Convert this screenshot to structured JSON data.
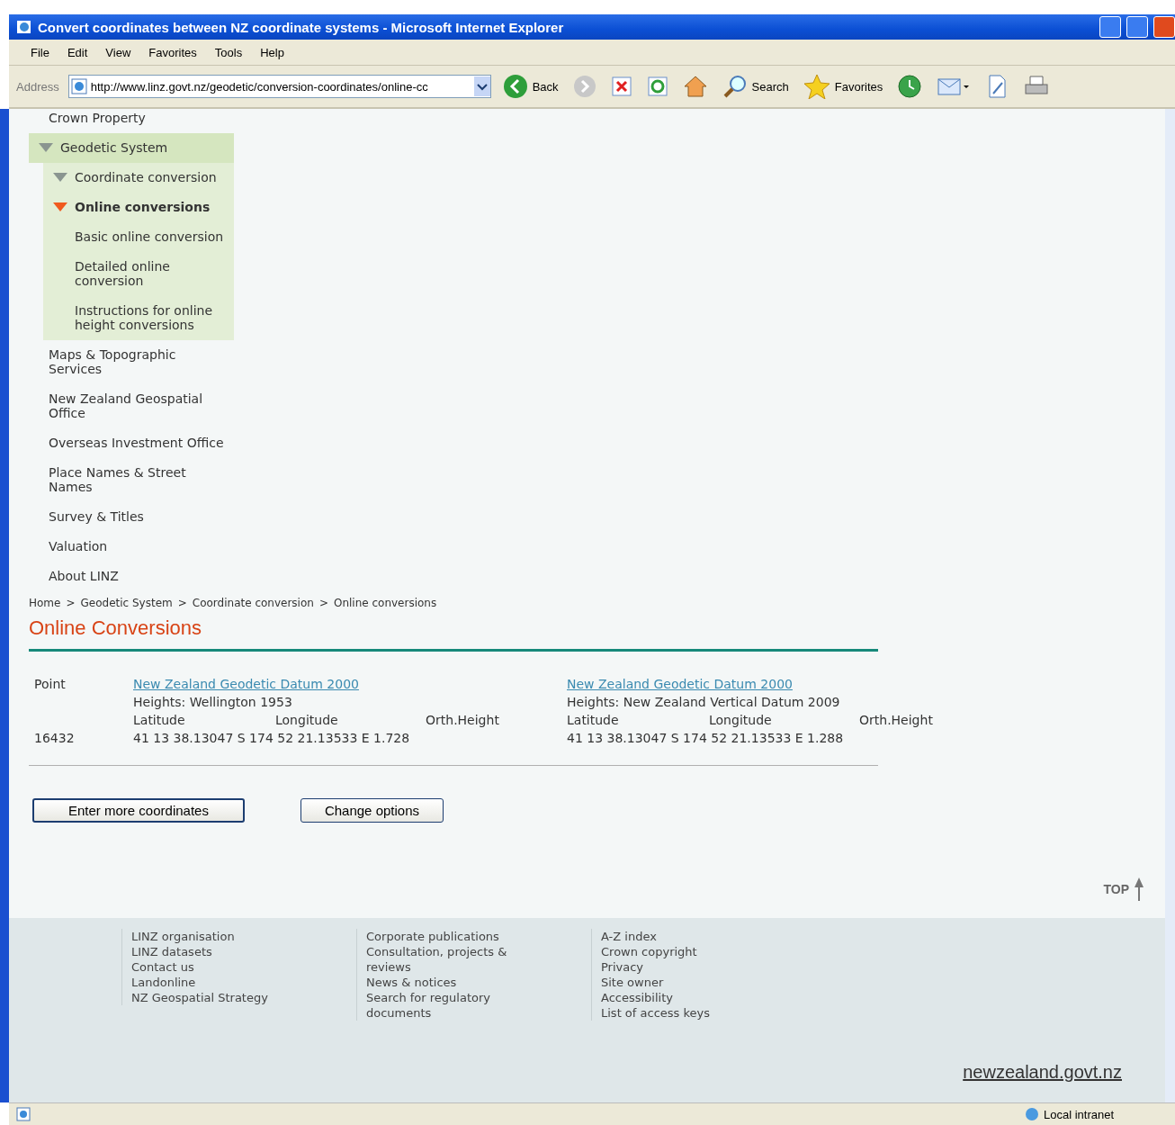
{
  "window": {
    "title": "Convert coordinates between NZ coordinate systems - Microsoft Internet Explorer"
  },
  "menu": [
    "File",
    "Edit",
    "View",
    "Favorites",
    "Tools",
    "Help"
  ],
  "toolbar": {
    "address_label": "Address",
    "address": "http://www.linz.govt.nz/geodetic/conversion-coordinates/online-cc",
    "buttons": [
      {
        "kind": "back",
        "label": "Back"
      },
      {
        "kind": "forward"
      },
      {
        "kind": "stop"
      },
      {
        "kind": "refresh"
      },
      {
        "kind": "home"
      },
      {
        "kind": "search",
        "label": "Search"
      },
      {
        "kind": "favorites",
        "label": "Favorites"
      },
      {
        "kind": "history"
      },
      {
        "kind": "mail"
      },
      {
        "kind": "edit"
      },
      {
        "kind": "print"
      }
    ]
  },
  "nav": [
    {
      "label": "Crown Property",
      "expanded": false,
      "selected": false
    },
    {
      "label": "Geodetic System",
      "expanded": true,
      "selected": false,
      "children": [
        {
          "label": "Coordinate conversion",
          "expanded": true,
          "selected": false,
          "children": [
            {
              "label": "Online conversions",
              "expanded": true,
              "selected": true,
              "children": [
                {
                  "label": "Basic online conversion",
                  "expanded": false,
                  "selected": false
                },
                {
                  "label": "Detailed online conversion",
                  "expanded": false,
                  "selected": false
                },
                {
                  "label": "Instructions for online height conversions",
                  "expanded": false,
                  "selected": false
                }
              ]
            }
          ]
        }
      ]
    },
    {
      "label": "Maps & Topographic Services",
      "expanded": false,
      "selected": false
    },
    {
      "label": "New Zealand Geospatial Office",
      "expanded": false,
      "selected": false
    },
    {
      "label": "Overseas Investment Office",
      "expanded": false,
      "selected": false
    },
    {
      "label": "Place Names & Street Names",
      "expanded": false,
      "selected": false
    },
    {
      "label": "Survey & Titles",
      "expanded": false,
      "selected": false
    },
    {
      "label": "Valuation",
      "expanded": false,
      "selected": false
    },
    {
      "label": "About LINZ",
      "expanded": false,
      "selected": false
    }
  ],
  "breadcrumb": [
    "Home",
    "Geodetic System",
    "Coordinate conversion",
    "Online conversions"
  ],
  "breadcrumb_separator": ">",
  "heading": "Online Conversions",
  "results": {
    "point_label": "Point",
    "point_id": "16432",
    "systems": [
      {
        "datum": "New Zealand Geodetic Datum 2000",
        "heights": "Heights: Wellington 1953",
        "headers": [
          "Latitude",
          "Longitude",
          "Orth.Height"
        ],
        "values": "41 13 38.13047 S 174 52 21.13533 E 1.728"
      },
      {
        "datum": "New Zealand Geodetic Datum 2000",
        "heights": "Heights: New Zealand Vertical Datum 2009",
        "headers": [
          "Latitude",
          "Longitude",
          "Orth.Height"
        ],
        "values": "41 13 38.13047 S 174 52 21.13533 E 1.288"
      }
    ]
  },
  "buttons": [
    {
      "label": "Enter more coordinates",
      "default": true
    },
    {
      "label": "Change options",
      "default": false
    }
  ],
  "top_link": "TOP",
  "footer": [
    [
      "LINZ organisation",
      "LINZ datasets",
      "Contact us",
      "Landonline",
      "NZ Geospatial Strategy"
    ],
    [
      "Corporate publications",
      "Consultation, projects & reviews",
      "News & notices",
      "Search for regulatory documents"
    ],
    [
      "A-Z index",
      "Crown copyright",
      "Privacy",
      "Site owner",
      "Accessibility",
      "List of access keys"
    ]
  ],
  "brand": "newzealand.govt.nz",
  "status_bar": {
    "zone": "Local intranet"
  }
}
